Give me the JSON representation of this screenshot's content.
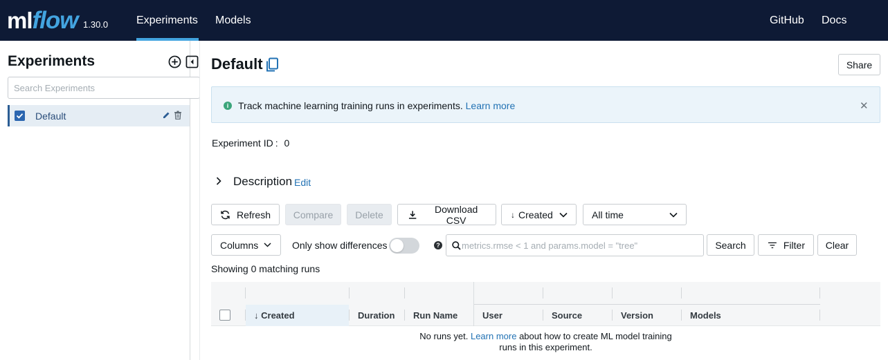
{
  "header": {
    "logo_ml": "ml",
    "logo_flow": "flow",
    "version": "1.30.0",
    "nav": [
      {
        "label": "Experiments",
        "active": true
      },
      {
        "label": "Models",
        "active": false
      }
    ],
    "right_links": [
      {
        "label": "GitHub"
      },
      {
        "label": "Docs"
      }
    ],
    "colors": {
      "background": "#0e1a35",
      "accent": "#43a4e0"
    }
  },
  "sidebar": {
    "title": "Experiments",
    "add_icon": "plus-circle-icon",
    "collapse_icon": "collapse-left-icon",
    "search_placeholder": "Search Experiments",
    "experiments": [
      {
        "label": "Default",
        "checked": true,
        "edit_icon": "pencil-icon",
        "delete_icon": "trash-icon"
      }
    ]
  },
  "main": {
    "title": "Default",
    "title_icon": "copy-icon",
    "share_label": "Share",
    "banner": {
      "text": "Track machine learning training runs in experiments.",
      "link": "Learn more",
      "info_icon": "info-icon",
      "close_icon": "close-icon"
    },
    "experiment_id_label": "Experiment ID",
    "experiment_id_sep": ":",
    "experiment_id_value": "0",
    "description": {
      "label": "Description",
      "edit": "Edit"
    },
    "toolbar": {
      "refresh": "Refresh",
      "compare": "Compare",
      "delete": "Delete",
      "download_csv": "Download CSV",
      "sort": "Created",
      "time_range": "All time"
    },
    "filters": {
      "columns": "Columns",
      "only_diff": "Only show differences",
      "only_diff_enabled": false,
      "search_placeholder": "metrics.rmse < 1 and params.model = \"tree\"",
      "search_button": "Search",
      "filter_button": "Filter",
      "clear_button": "Clear"
    },
    "showing": "Showing 0 matching runs",
    "table": {
      "columns": [
        "Created",
        "Duration",
        "Run Name",
        "User",
        "Source",
        "Version",
        "Models"
      ],
      "sort_indicator": "↓"
    },
    "empty": {
      "prefix": "No runs yet.",
      "link": "Learn more",
      "suffix_1": "about how to create ML model training",
      "suffix_2": "runs in this experiment."
    }
  }
}
